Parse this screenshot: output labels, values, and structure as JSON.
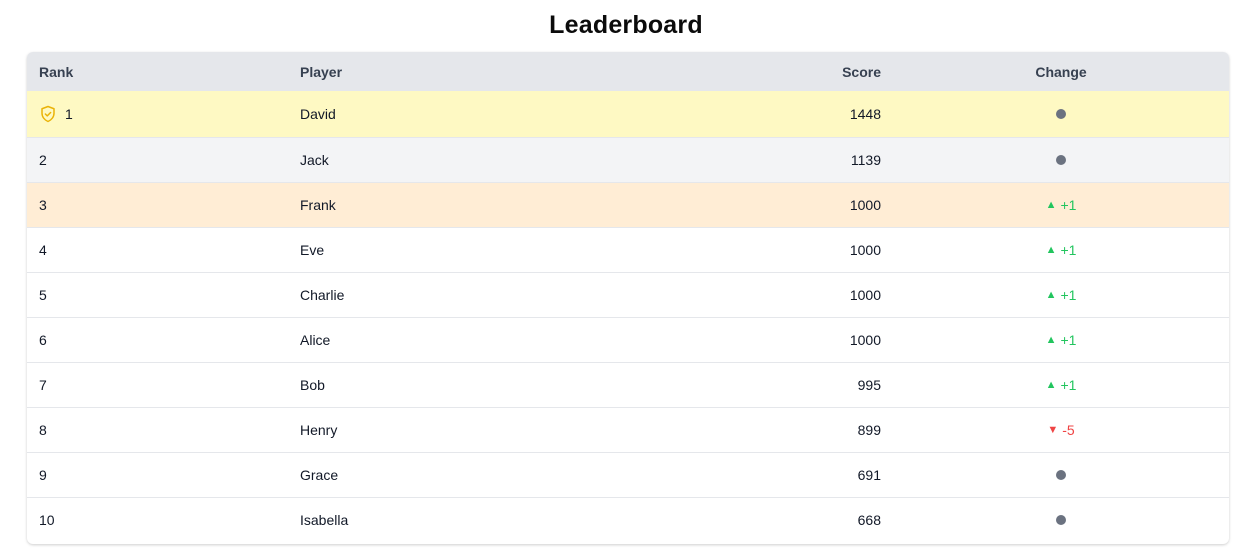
{
  "title": "Leaderboard",
  "columns": {
    "rank": "Rank",
    "player": "Player",
    "score": "Score",
    "change": "Change"
  },
  "colors": {
    "first_row": "#fef9c3",
    "second_row": "#f3f4f6",
    "third_row": "#ffedd5",
    "header": "#e5e7eb",
    "up": "#22c55e",
    "down": "#ef4444",
    "neutral": "#6b7280"
  },
  "icons": {
    "first_place": "shield-check-icon",
    "up": "triangle-up-icon",
    "down": "triangle-down-icon",
    "neutral": "dot-icon"
  },
  "rows": [
    {
      "rank": "1",
      "player": "David",
      "score": "1448",
      "change_type": "neutral",
      "change": ""
    },
    {
      "rank": "2",
      "player": "Jack",
      "score": "1139",
      "change_type": "neutral",
      "change": ""
    },
    {
      "rank": "3",
      "player": "Frank",
      "score": "1000",
      "change_type": "up",
      "change": "+1"
    },
    {
      "rank": "4",
      "player": "Eve",
      "score": "1000",
      "change_type": "up",
      "change": "+1"
    },
    {
      "rank": "5",
      "player": "Charlie",
      "score": "1000",
      "change_type": "up",
      "change": "+1"
    },
    {
      "rank": "6",
      "player": "Alice",
      "score": "1000",
      "change_type": "up",
      "change": "+1"
    },
    {
      "rank": "7",
      "player": "Bob",
      "score": "995",
      "change_type": "up",
      "change": "+1"
    },
    {
      "rank": "8",
      "player": "Henry",
      "score": "899",
      "change_type": "down",
      "change": "-5"
    },
    {
      "rank": "9",
      "player": "Grace",
      "score": "691",
      "change_type": "neutral",
      "change": ""
    },
    {
      "rank": "10",
      "player": "Isabella",
      "score": "668",
      "change_type": "neutral",
      "change": ""
    }
  ]
}
